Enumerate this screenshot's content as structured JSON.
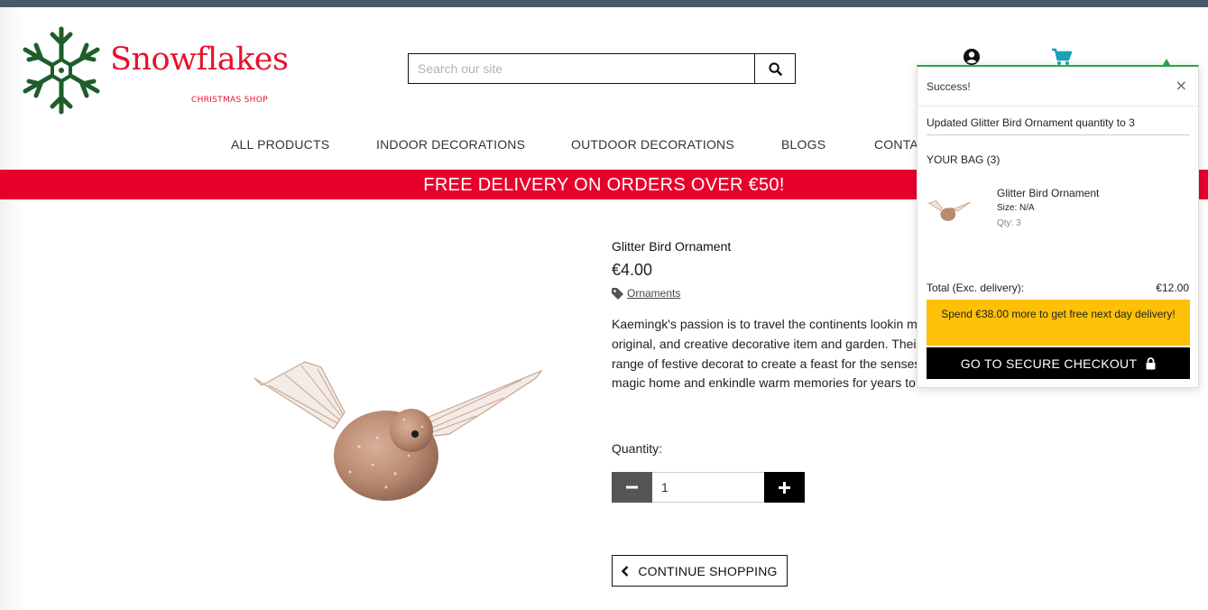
{
  "brand": {
    "name": "Snowflakes",
    "subtitle": "CHRISTMAS SHOP",
    "color": "#e8112d",
    "flake_color": "#1d5e2a"
  },
  "search": {
    "placeholder": "Search our site",
    "icon": "search-icon"
  },
  "header_icons": [
    "account-icon",
    "cart-icon",
    "tree-icon"
  ],
  "nav": {
    "items": [
      {
        "label": "ALL PRODUCTS"
      },
      {
        "label": "INDOOR DECORATIONS"
      },
      {
        "label": "OUTDOOR DECORATIONS"
      },
      {
        "label": "BLOGS"
      },
      {
        "label": "CONTA"
      }
    ]
  },
  "promo": {
    "text": "FREE DELIVERY ON ORDERS OVER €50!",
    "color": "#e8002d"
  },
  "product": {
    "name": "Glitter Bird Ornament",
    "price": "€4.00",
    "category": "Ornaments",
    "description": "Kaemingk's passion is to travel the continents lookin most beautiful, original, and creative decorative item and garden. Their exquisite range of festive decorat to create a feast for the senses, bringing the magic home and enkindle warm memories for years to come.",
    "quantity_label": "Quantity:",
    "quantity_value": "1",
    "continue_label": "CONTINUE SHOPPING"
  },
  "toast": {
    "title": "Success!",
    "close": "×",
    "message": "Updated Glitter Bird Ornament quantity to 3",
    "bag_title": "YOUR BAG (3)",
    "item": {
      "name": "Glitter Bird Ornament",
      "size": "Size: N/A",
      "qty": "Qty: 3"
    },
    "total_label": "Total (Exc. delivery):",
    "total_value": "€12.00",
    "spend_more": "Spend €38.00 more to get free next day delivery!",
    "checkout_label": "GO TO SECURE CHECKOUT",
    "accent": "#28a745",
    "spend_color": "#ffc107"
  }
}
